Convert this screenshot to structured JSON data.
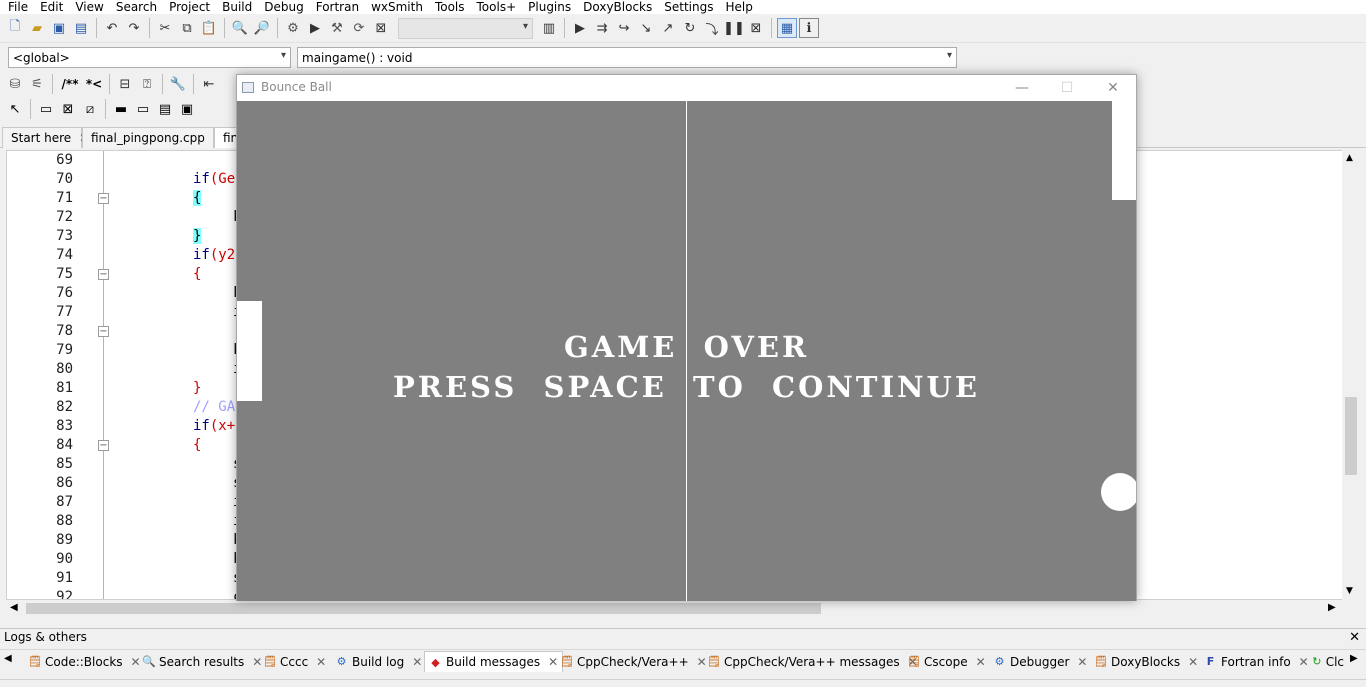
{
  "menu": [
    "File",
    "Edit",
    "View",
    "Search",
    "Project",
    "Build",
    "Debug",
    "Fortran",
    "wxSmith",
    "Tools",
    "Tools+",
    "Plugins",
    "DoxyBlocks",
    "Settings",
    "Help"
  ],
  "toolbar": {
    "doxy_block_comment": "/**",
    "doxy_line_comment": "*<"
  },
  "scope": {
    "global_selector": "<global>",
    "function_selector": "maingame() : void"
  },
  "editor_tabs": [
    {
      "label": "Start here"
    },
    {
      "label": "final_pingpong.cpp"
    },
    {
      "label": "fina"
    }
  ],
  "editor": {
    "line_numbers": [
      "69",
      "70",
      "71",
      "72",
      "73",
      "74",
      "75",
      "76",
      "77",
      "78",
      "79",
      "80",
      "81",
      "82",
      "83",
      "84",
      "85",
      "86",
      "87",
      "88",
      "89",
      "90",
      "91",
      "92"
    ],
    "code": {
      "l70_kw": "if",
      "l70_rest": "(Ge",
      "l71": "{",
      "l72": "k",
      "l73": "}",
      "l74_kw": "if",
      "l74_rest": "(y2",
      "l75": "{",
      "l76": "k",
      "l77": "i",
      "l79": "k",
      "l80": "i",
      "l81": "}",
      "l82": "// GA",
      "l83_kw": "if",
      "l83_rest": "(x+",
      "l84": "{",
      "l85": "s",
      "l86": "s",
      "l87": "i",
      "l88": "i",
      "l89": "k",
      "l90": "k",
      "l91": "s",
      "l92": "c"
    }
  },
  "game_window": {
    "title": "Bounce Ball",
    "minimize": "—",
    "maximize": "☐",
    "close": "✕",
    "text_line1": "GAME  OVER",
    "text_line2": "PRESS  SPACE  TO  CONTINUE"
  },
  "logs": {
    "title": "Logs & others",
    "close": "✕",
    "tabs": [
      {
        "label": "Code::Blocks",
        "icon": "notepad-icon"
      },
      {
        "label": "Search results",
        "icon": "magnifier-icon"
      },
      {
        "label": "Cccc",
        "icon": "notepad-icon"
      },
      {
        "label": "Build log",
        "icon": "gear-icon"
      },
      {
        "label": "Build messages",
        "icon": "pin-icon"
      },
      {
        "label": "CppCheck/Vera++",
        "icon": "notepad-icon"
      },
      {
        "label": "CppCheck/Vera++ messages",
        "icon": "notepad-icon"
      },
      {
        "label": "Cscope",
        "icon": "notepad-icon"
      },
      {
        "label": "Debugger",
        "icon": "gear-icon"
      },
      {
        "label": "DoxyBlocks",
        "icon": "notepad-icon"
      },
      {
        "label": "Fortran info",
        "icon": "fortran-icon"
      },
      {
        "label": "Clc",
        "icon": "arrow-icon"
      }
    ]
  },
  "colors": {
    "game_background": "#808080",
    "game_foreground": "#ffffff",
    "keyword": "#00008b",
    "brace": "#d00000",
    "brace_highlight": "#80ffff",
    "comment": "#a0a0ff"
  }
}
